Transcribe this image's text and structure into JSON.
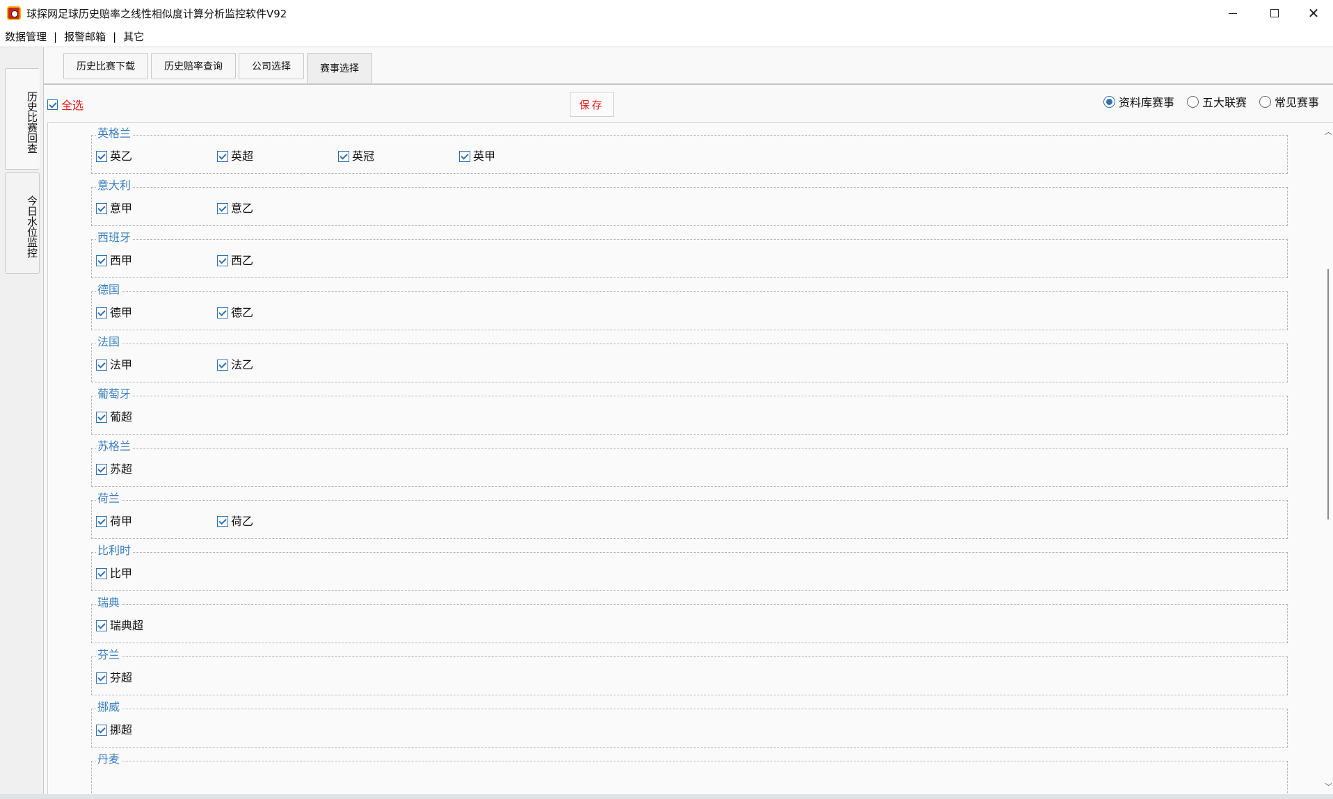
{
  "window": {
    "title": "球探网足球历史赔率之线性相似度计算分析监控软件V92",
    "minimize_glyph": "—",
    "maximize_glyph": "□",
    "close_glyph": "✕"
  },
  "menu": [
    "数据管理",
    "报警邮箱",
    "其它"
  ],
  "menu_separator": "|",
  "side_tabs": [
    {
      "label": "历史比赛回查",
      "active": true
    },
    {
      "label": "今日水位监控",
      "active": false
    }
  ],
  "tabs": [
    {
      "label": "历史比赛下载",
      "active": false
    },
    {
      "label": "历史赔率查询",
      "active": false
    },
    {
      "label": "公司选择",
      "active": false
    },
    {
      "label": "赛事选择",
      "active": true
    }
  ],
  "toolbar": {
    "select_all_label": "全选",
    "select_all_checked": true,
    "save_label": "保存",
    "radios": [
      {
        "label": "资料库赛事",
        "checked": true
      },
      {
        "label": "五大联赛",
        "checked": false
      },
      {
        "label": "常见赛事",
        "checked": false
      }
    ]
  },
  "groups": [
    {
      "title": "英格兰",
      "items": [
        "英乙",
        "英超",
        "英冠",
        "英甲"
      ]
    },
    {
      "title": "意大利",
      "items": [
        "意甲",
        "意乙"
      ]
    },
    {
      "title": "西班牙",
      "items": [
        "西甲",
        "西乙"
      ]
    },
    {
      "title": "德国",
      "items": [
        "德甲",
        "德乙"
      ]
    },
    {
      "title": "法国",
      "items": [
        "法甲",
        "法乙"
      ]
    },
    {
      "title": "葡萄牙",
      "items": [
        "葡超"
      ]
    },
    {
      "title": "苏格兰",
      "items": [
        "苏超"
      ]
    },
    {
      "title": "荷兰",
      "items": [
        "荷甲",
        "荷乙"
      ]
    },
    {
      "title": "比利时",
      "items": [
        "比甲"
      ]
    },
    {
      "title": "瑞典",
      "items": [
        "瑞典超"
      ]
    },
    {
      "title": "芬兰",
      "items": [
        "芬超"
      ]
    },
    {
      "title": "挪威",
      "items": [
        "挪超"
      ]
    },
    {
      "title": "丹麦",
      "items": []
    }
  ],
  "colors": {
    "accent_blue": "#2f6fb3",
    "group_title": "#3a7fbf",
    "red_text": "#e02020"
  }
}
